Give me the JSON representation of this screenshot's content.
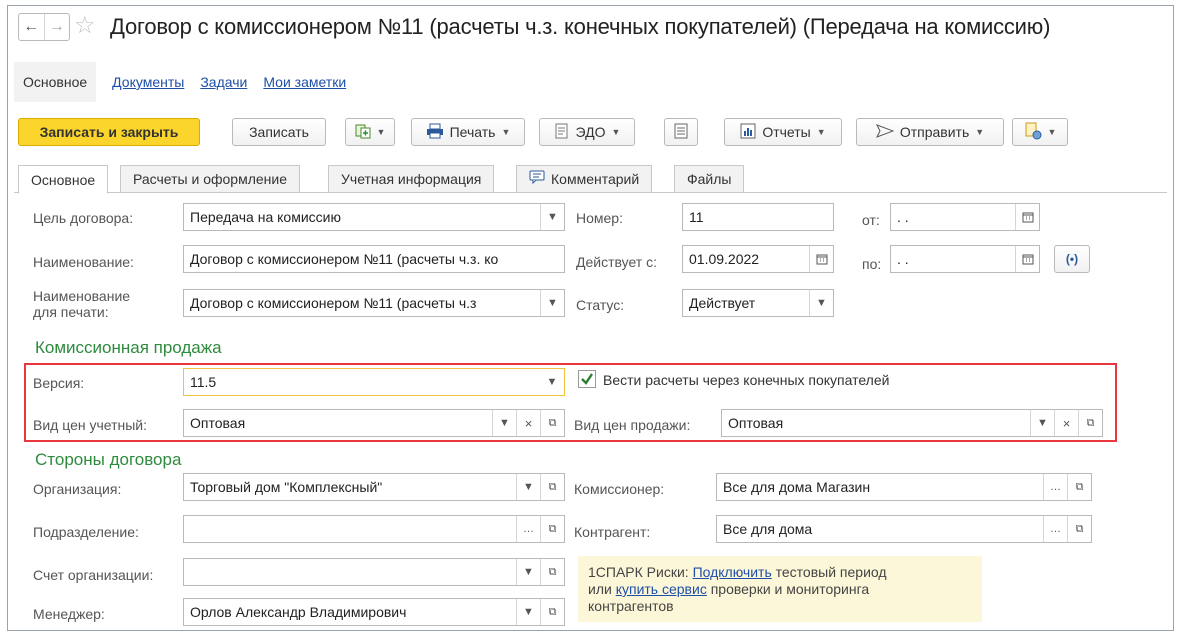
{
  "window": {
    "title": "Договор с комиссионером №11 (расчеты ч.з. конечных покупателей) (Передача на комиссию)"
  },
  "nav": {
    "back": "←",
    "forward": "→",
    "links": [
      "Основное",
      "Документы",
      "Задачи",
      "Мои заметки"
    ]
  },
  "toolbar": {
    "save_close": "Записать и закрыть",
    "save": "Записать",
    "print": "Печать",
    "edo": "ЭДО",
    "reports": "Отчеты",
    "send": "Отправить"
  },
  "tabs": [
    "Основное",
    "Расчеты и оформление",
    "Учетная информация",
    "Комментарий",
    "Файлы"
  ],
  "form": {
    "purpose_label": "Цель договора:",
    "purpose_value": "Передача на комиссию",
    "number_label": "Номер:",
    "number_value": "11",
    "from_label": "от:",
    "from_value": " .  .",
    "name_label": "Наименование:",
    "name_value": "Договор с комиссионером №11 (расчеты ч.з. ко",
    "valid_from_label": "Действует с:",
    "valid_from_value": "01.09.2022",
    "to_label": "по:",
    "to_value": " .  .",
    "print_name_label_1": "Наименование",
    "print_name_label_2": "для печати:",
    "print_name_value": "Договор с комиссионером №11 (расчеты ч.з",
    "status_label": "Статус:",
    "status_value": "Действует"
  },
  "commission": {
    "section_title": "Комиссионная продажа",
    "version_label": "Версия:",
    "version_value": "11.5",
    "checkbox_label": "Вести расчеты через конечных покупателей",
    "checkbox_checked": true,
    "price_acc_label": "Вид цен учетный:",
    "price_acc_value": "Оптовая",
    "price_sale_label": "Вид цен продажи:",
    "price_sale_value": "Оптовая"
  },
  "parties": {
    "section_title": "Стороны договора",
    "org_label": "Организация:",
    "org_value": "Торговый дом \"Комплексный\"",
    "dept_label": "Подразделение:",
    "dept_value": "",
    "account_label": "Счет организации:",
    "account_value": "",
    "manager_label": "Менеджер:",
    "manager_value": "Орлов Александр Владимирович",
    "agent_label": "Комиссионер:",
    "agent_value": "Все для дома Магазин",
    "counterparty_label": "Контрагент:",
    "counterparty_value": "Все для дома"
  },
  "spark": {
    "prefix": "1СПАРК Риски: ",
    "connect": "Подключить",
    "mid": " тестовый период",
    "or": "или ",
    "buy": "купить сервис",
    "suffix": " проверки и мониторинга",
    "line3": "контрагентов"
  },
  "colors": {
    "primary_button": "#fbd52b",
    "section_green": "#2e8b3d",
    "highlight_red": "#e8383d",
    "link_blue": "#1e4fa8"
  }
}
